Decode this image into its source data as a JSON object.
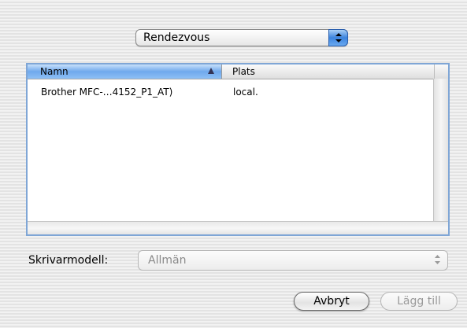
{
  "source_popup": {
    "selected": "Rendezvous"
  },
  "printer_list": {
    "columns": [
      "Namn",
      "Plats"
    ],
    "sorted_column": "Namn",
    "rows": [
      {
        "name": "Brother MFC-…4152_P1_AT)",
        "location": "local."
      }
    ]
  },
  "model": {
    "label": "Skrivarmodell:",
    "value": "Allmän",
    "enabled": false
  },
  "buttons": {
    "cancel": "Avbryt",
    "add": "Lägg till",
    "add_enabled": false
  },
  "colors": {
    "accent": "#3b83dd",
    "list_border": "#7fa6d6"
  }
}
